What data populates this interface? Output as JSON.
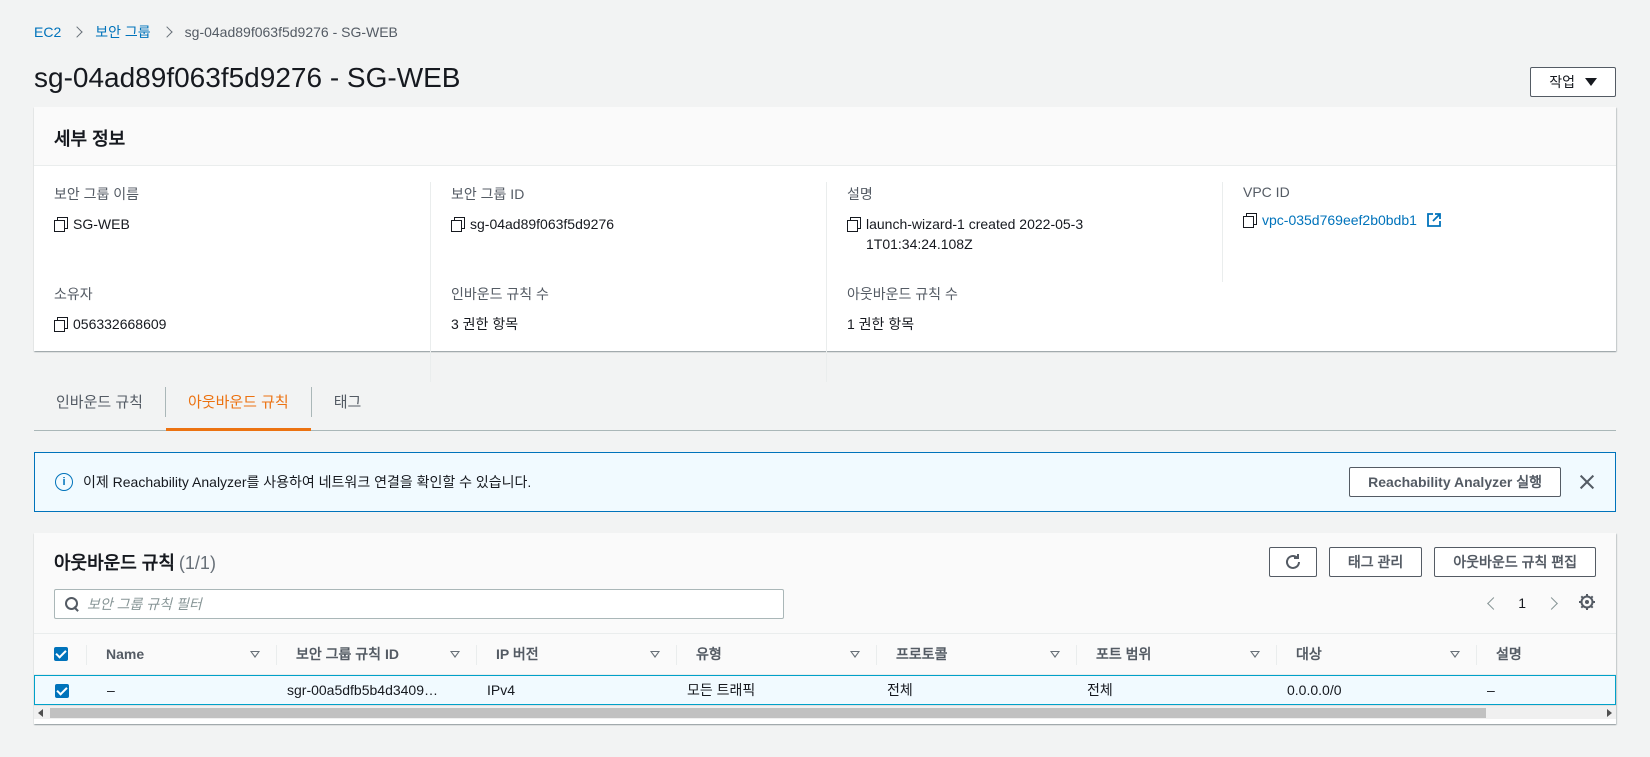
{
  "breadcrumb": {
    "root": "EC2",
    "parent": "보안 그룹",
    "current": "sg-04ad89f063f5d9276 - SG-WEB"
  },
  "page": {
    "title": "sg-04ad89f063f5d9276 - SG-WEB",
    "actions_label": "작업"
  },
  "details": {
    "header": "세부 정보",
    "fields": {
      "sg_name": {
        "label": "보안 그룹 이름",
        "value": "SG-WEB"
      },
      "sg_id": {
        "label": "보안 그룹 ID",
        "value": "sg-04ad89f063f5d9276"
      },
      "description": {
        "label": "설명",
        "value": "launch-wizard-1 created 2022-05-31T01:34:24.108Z"
      },
      "vpc_id": {
        "label": "VPC ID",
        "value": "vpc-035d769eef2b0bdb1"
      },
      "owner": {
        "label": "소유자",
        "value": "056332668609"
      },
      "inbound_count": {
        "label": "인바운드 규칙 수",
        "value": "3 권한 항목"
      },
      "outbound_count": {
        "label": "아웃바운드 규칙 수",
        "value": "1 권한 항목"
      }
    }
  },
  "tabs": [
    {
      "label": "인바운드 규칙"
    },
    {
      "label": "아웃바운드 규칙"
    },
    {
      "label": "태그"
    }
  ],
  "alert": {
    "text": "이제 Reachability Analyzer를 사용하여 네트워크 연결을 확인할 수 있습니다.",
    "button": "Reachability Analyzer 실행",
    "icon": "info-icon"
  },
  "rules": {
    "title": "아웃바운드 규칙",
    "count": "(1/1)",
    "manage_tags": "태그 관리",
    "edit_rules": "아웃바운드 규칙 편집",
    "filter_placeholder": "보안 그룹 규칙 필터",
    "page": "1",
    "columns": [
      "Name",
      "보안 그룹 규칙 ID",
      "IP 버전",
      "유형",
      "프로토콜",
      "포트 범위",
      "대상",
      "설명"
    ],
    "rows": [
      {
        "name": "–",
        "rule_id": "sgr-00a5dfb5b4d3409…",
        "ip_version": "IPv4",
        "type": "모든 트래픽",
        "protocol": "전체",
        "port_range": "전체",
        "destination": "0.0.0.0/0",
        "description": "–"
      }
    ]
  },
  "colors": {
    "accent": "#ec7211",
    "link": "#0073bb",
    "selected_bg": "#f1faff"
  }
}
